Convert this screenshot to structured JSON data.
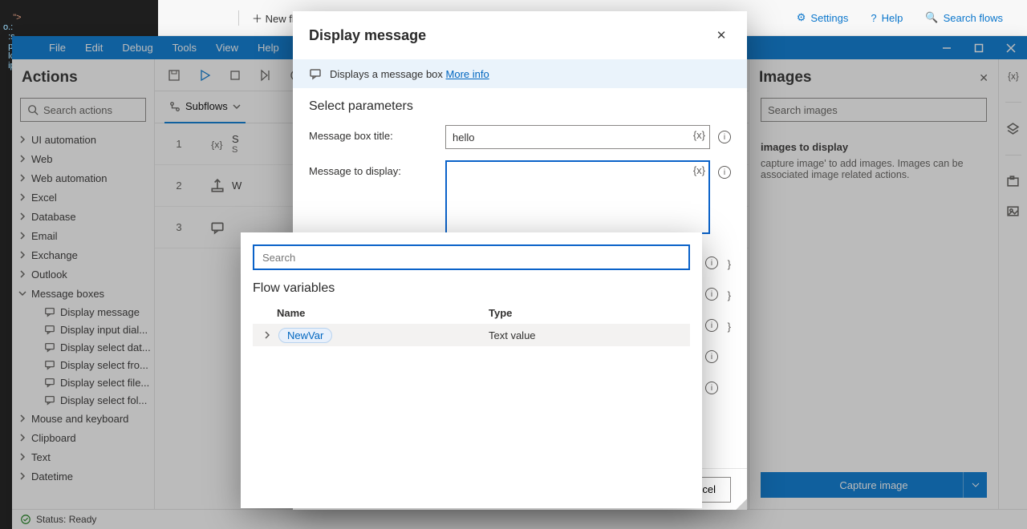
{
  "toprow": {
    "newflow": "New flow",
    "settings": "Settings",
    "help": "Help",
    "search": "Search flows"
  },
  "menu": {
    "file": "File",
    "edit": "Edit",
    "debug": "Debug",
    "tools": "Tools",
    "view": "View",
    "help": "Help"
  },
  "actions": {
    "title": "Actions",
    "search_placeholder": "Search actions",
    "cats": [
      "UI automation",
      "Web",
      "Web automation",
      "Excel",
      "Database",
      "Email",
      "Exchange",
      "Outlook",
      "Message boxes",
      "Mouse and keyboard",
      "Clipboard",
      "Text",
      "Datetime"
    ],
    "open_cat": "Message boxes",
    "msgbox_items": [
      "Display message",
      "Display input dial...",
      "Display select dat...",
      "Display select fro...",
      "Display select file...",
      "Display select fol..."
    ]
  },
  "subflow_label": "Subflows",
  "flow_rows": [
    {
      "num": "1",
      "title": "S",
      "sub": "S"
    },
    {
      "num": "2",
      "title": "W"
    },
    {
      "num": "3",
      "title": ""
    }
  ],
  "images": {
    "title": "Images",
    "search_placeholder": "Search images",
    "empty_title": "images to display",
    "empty_hint": "capture image' to add images. Images can be associated image related actions.",
    "capture": "Capture image"
  },
  "status": "Status: Ready",
  "modal": {
    "title": "Display message",
    "desc": "Displays a message box",
    "more": "More info",
    "section": "Select parameters",
    "p_title_label": "Message box title:",
    "p_title_value": "hello",
    "p_msg_label": "Message to display:",
    "var_token": "{x}",
    "cancel": "ncel"
  },
  "var_popup": {
    "search_placeholder": "Search",
    "heading": "Flow variables",
    "col_name": "Name",
    "col_type": "Type",
    "row_name": "NewVar",
    "row_type": "Text value"
  }
}
